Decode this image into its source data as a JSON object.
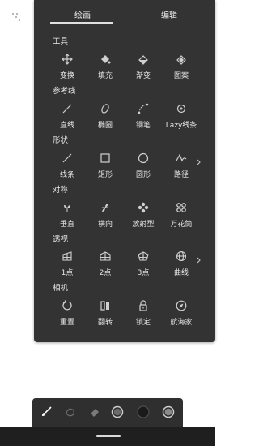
{
  "tabs": [
    {
      "label": "绘画",
      "active": true
    },
    {
      "label": "编辑",
      "active": false
    }
  ],
  "sections": {
    "tools": {
      "title": "工具",
      "items": [
        {
          "label": "变换",
          "icon": "move-arrows-icon"
        },
        {
          "label": "填充",
          "icon": "paint-bucket-icon"
        },
        {
          "label": "渐变",
          "icon": "gradient-icon"
        },
        {
          "label": "图案",
          "icon": "pattern-fill-icon"
        }
      ]
    },
    "guides": {
      "title": "参考线",
      "items": [
        {
          "label": "直线",
          "icon": "straight-line-icon"
        },
        {
          "label": "椭圆",
          "icon": "ellipse-guide-icon"
        },
        {
          "label": "钢笔",
          "icon": "pen-curve-icon"
        },
        {
          "label": "Lazy线条",
          "icon": "lazy-line-icon"
        }
      ]
    },
    "shapes": {
      "title": "形状",
      "items": [
        {
          "label": "线条",
          "icon": "line-shape-icon"
        },
        {
          "label": "矩形",
          "icon": "rectangle-icon"
        },
        {
          "label": "圆形",
          "icon": "circle-icon"
        },
        {
          "label": "路径",
          "icon": "path-icon"
        }
      ]
    },
    "symmetry": {
      "title": "对称",
      "items": [
        {
          "label": "垂直",
          "icon": "vertical-symmetry-icon"
        },
        {
          "label": "横向",
          "icon": "horizontal-symmetry-icon"
        },
        {
          "label": "放射型",
          "icon": "radial-symmetry-icon"
        },
        {
          "label": "万花筒",
          "icon": "kaleidoscope-icon"
        }
      ]
    },
    "perspective": {
      "title": "透视",
      "items": [
        {
          "label": "1点",
          "icon": "one-point-perspective-icon"
        },
        {
          "label": "2点",
          "icon": "two-point-perspective-icon"
        },
        {
          "label": "3点",
          "icon": "three-point-perspective-icon"
        },
        {
          "label": "曲线",
          "icon": "curve-perspective-icon"
        }
      ]
    },
    "camera": {
      "title": "相机",
      "items": [
        {
          "label": "重置",
          "icon": "reset-icon"
        },
        {
          "label": "翻转",
          "icon": "flip-icon"
        },
        {
          "label": "锁定",
          "icon": "lock-icon"
        },
        {
          "label": "航海家",
          "icon": "navigator-compass-icon"
        }
      ]
    }
  },
  "bottom_toolbar": [
    {
      "icon": "brush-icon"
    },
    {
      "icon": "smudge-icon"
    },
    {
      "icon": "eraser-icon"
    },
    {
      "icon": "brush-size-icon"
    },
    {
      "icon": "color-swatch-icon"
    },
    {
      "icon": "opacity-icon"
    }
  ],
  "colors": {
    "panel": "#333333",
    "text": "#e6e6e6",
    "icon": "#d0d0d0",
    "toolbar": "#2f2f2f"
  }
}
